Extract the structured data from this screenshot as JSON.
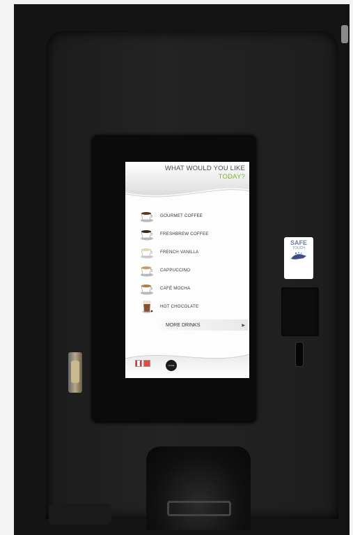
{
  "screen": {
    "title_line1": "WHAT WOULD YOU LIKE",
    "title_line2": "TODAY?",
    "menu": [
      {
        "label": "GOURMET COFFEE",
        "icon": "coffee-cup-icon"
      },
      {
        "label": "FRESHBREW COFFEE",
        "icon": "coffee-cup-icon"
      },
      {
        "label": "FRENCH VANILLA",
        "icon": "vanilla-cup-icon"
      },
      {
        "label": "CAPPUCCINO",
        "icon": "cappuccino-cup-icon"
      },
      {
        "label": "CAFÉ MOCHA",
        "icon": "mocha-cup-icon"
      },
      {
        "label": "HOT CHOCOLATE",
        "icon": "hot-chocolate-glass-icon"
      }
    ],
    "more_label": "MORE DRINKS",
    "home_label": "HOME",
    "accent": "#7cb23a"
  },
  "sticker": {
    "title": "SAFE",
    "sub": "TOUCH"
  }
}
